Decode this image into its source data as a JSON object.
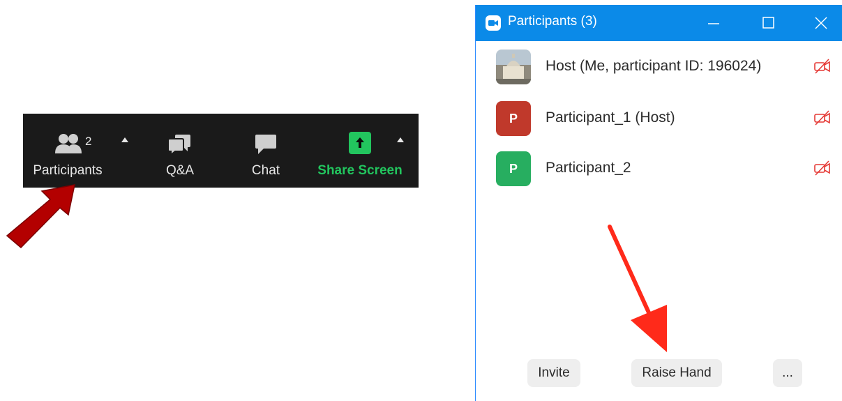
{
  "toolbar": {
    "participants": {
      "label": "Participants",
      "count": "2"
    },
    "qa": {
      "label": "Q&A"
    },
    "chat": {
      "label": "Chat"
    },
    "share": {
      "label": "Share Screen"
    }
  },
  "window": {
    "title": "Participants (3)",
    "participants": [
      {
        "name": "Host (Me, participant ID: 196024)",
        "avatar_type": "photo",
        "avatar_letter": ""
      },
      {
        "name": "Participant_1 (Host)",
        "avatar_type": "letter",
        "avatar_letter": "P",
        "avatar_color": "#c0392b"
      },
      {
        "name": "Participant_2",
        "avatar_type": "letter",
        "avatar_letter": "P",
        "avatar_color": "#27ae60"
      }
    ],
    "buttons": {
      "invite": "Invite",
      "raise_hand": "Raise Hand",
      "more": "..."
    }
  },
  "colors": {
    "toolbar_bg": "#1a1a1a",
    "titlebar_bg": "#0b8ae8",
    "share_green": "#22c55e",
    "camera_off_red": "#e53935",
    "annotation_arrow_dark": "#b30000",
    "annotation_arrow_bright": "#ff2a1a"
  },
  "icons": {
    "participants": "participants-icon",
    "qa": "qa-icon",
    "chat": "chat-icon",
    "share": "share-arrow-icon",
    "camera_off": "video-off-icon",
    "app": "zoom-app-icon"
  }
}
